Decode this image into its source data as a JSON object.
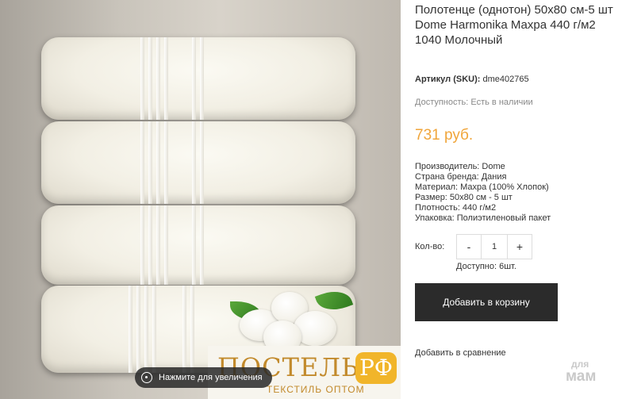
{
  "product": {
    "title": "Полотенце (однотон) 50x80 см-5 шт Dome Harmonika Махра 440 г/м2 1040 Молочный",
    "sku_label": "Артикул (SKU):",
    "sku_value": "dme402765",
    "availability_label": "Доступность:",
    "availability_value": "Есть в наличии",
    "price": "731 руб.",
    "specs": [
      "Производитель: Dome",
      "Страна бренда: Дания",
      "Материал: Махра (100% Хлопок)",
      "Размер: 50x80 см - 5 шт",
      "Плотность: 440 г/м2",
      "Упаковка: Полиэтиленовый пакет"
    ]
  },
  "quantity": {
    "label": "Кол-во:",
    "minus": "-",
    "value": "1",
    "plus": "+",
    "stock": "Доступно: 6шт."
  },
  "actions": {
    "add_to_cart": "Добавить в корзину",
    "add_to_compare": "Добавить в сравнение"
  },
  "image": {
    "zoom_label": "Нажмите для увеличения",
    "logo_main": "ПОСТЕЛЬ",
    "logo_badge": "РФ",
    "logo_sub": "ТЕКСТИЛЬ ОПТОМ"
  },
  "watermark": {
    "line1": "для",
    "line2": "мам"
  },
  "colors": {
    "price": "#f0a53a",
    "button_bg": "#2b2b2b",
    "logo": "#c28a2c"
  }
}
